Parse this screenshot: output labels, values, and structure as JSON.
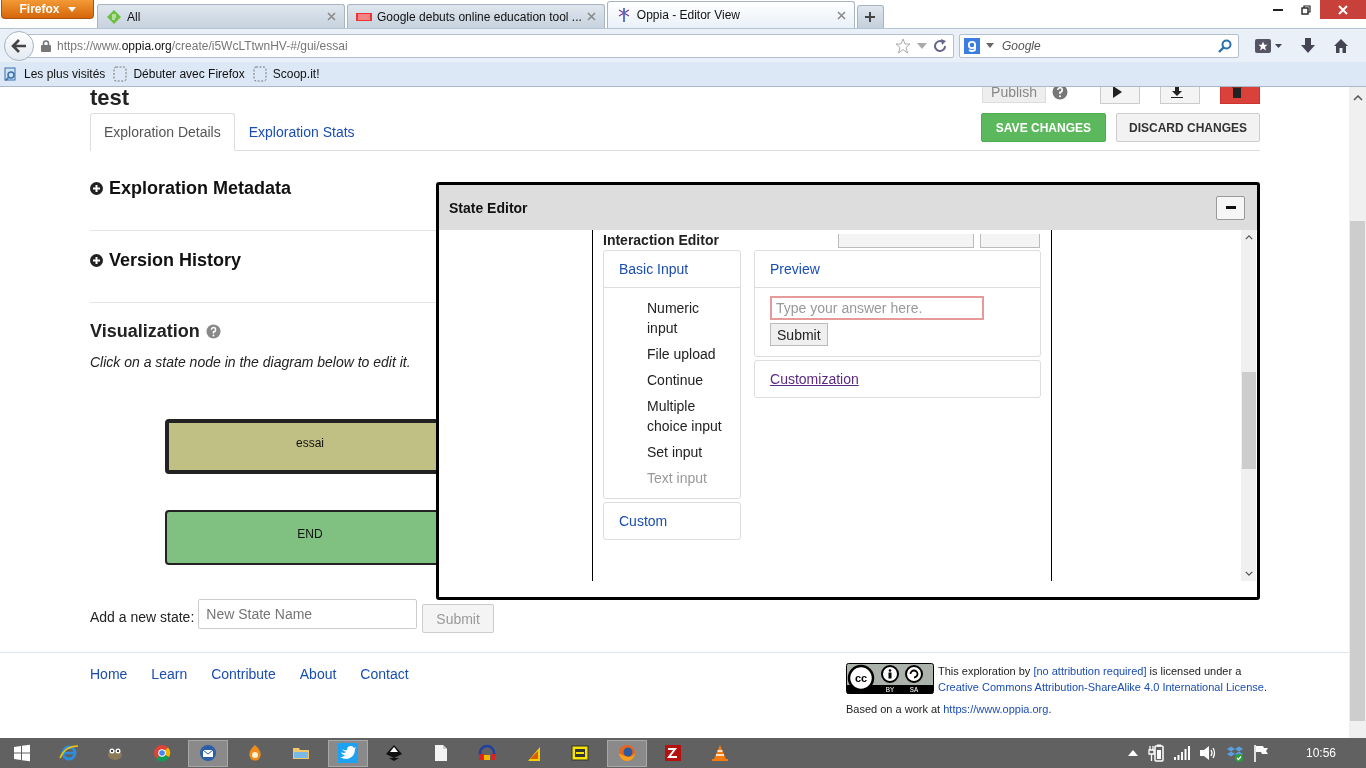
{
  "browser": {
    "menu_button": "Firefox",
    "tabs": [
      {
        "title": "All",
        "selected": false,
        "kind": "feed"
      },
      {
        "title": "Google debuts online education tool ...",
        "selected": false,
        "kind": "news"
      },
      {
        "title": "Oppia - Editor View",
        "selected": true,
        "kind": "site"
      }
    ],
    "address": {
      "prefix": "https://www.",
      "domain": "oppia.org",
      "path": "/create/i5WcLTtwnHV-#/gui/essai"
    },
    "search": {
      "placeholder": "Google"
    },
    "bookmarks": [
      {
        "label": "Les plus visités",
        "kind": "folder"
      },
      {
        "label": "Débuter avec Firefox",
        "kind": "page"
      },
      {
        "label": "Scoop.it!",
        "kind": "page"
      }
    ]
  },
  "page": {
    "title": "test",
    "publish_button": "Publish",
    "tabs": [
      {
        "label": "Exploration Details",
        "selected": true
      },
      {
        "label": "Exploration Stats",
        "selected": false
      }
    ],
    "save_button": "SAVE CHANGES",
    "discard_button": "DISCARD CHANGES",
    "sections": [
      {
        "title": "Exploration Metadata",
        "expanded": false
      },
      {
        "title": "Version History",
        "expanded": false
      }
    ],
    "visualization": {
      "title": "Visualization",
      "hint": "Click on a state node in the diagram below to edit it.",
      "nodes": [
        {
          "label": "essai",
          "selected": true,
          "color": "#c0c084"
        },
        {
          "label": "END",
          "selected": false,
          "color": "#80c080"
        }
      ]
    },
    "add_state": {
      "label": "Add a new state:",
      "placeholder": "New State Name",
      "submit": "Submit",
      "disabled": true
    }
  },
  "footer": {
    "links": [
      "Home",
      "Learn",
      "Contribute",
      "About",
      "Contact"
    ],
    "badge": {
      "mark": "cc",
      "labels": [
        "BY",
        "SA"
      ]
    },
    "license": [
      {
        "text": "This exploration by ",
        "kind": "plain"
      },
      {
        "text": "[no attribution required]",
        "kind": "link"
      },
      {
        "text": " is licensed under a ",
        "kind": "plain"
      },
      {
        "text": "Creative Commons Attribution-ShareAlike 4.0 International License",
        "kind": "link"
      },
      {
        "text": ".",
        "kind": "plain"
      }
    ],
    "source": [
      {
        "text": "Based on a work at ",
        "kind": "plain"
      },
      {
        "text": "https://www.oppia.org",
        "kind": "link"
      },
      {
        "text": ".",
        "kind": "plain"
      }
    ]
  },
  "state_editor": {
    "title": "State Editor",
    "heading": "Interaction Editor",
    "basic": {
      "title": "Basic Input",
      "items": [
        {
          "label": "Numeric input",
          "disabled": false
        },
        {
          "label": "File upload",
          "disabled": false
        },
        {
          "label": "Continue",
          "disabled": false
        },
        {
          "label": "Multiple choice input",
          "disabled": false
        },
        {
          "label": "Set input",
          "disabled": false
        },
        {
          "label": "Text input",
          "disabled": true
        }
      ]
    },
    "custom": "Custom",
    "preview": {
      "title": "Preview",
      "placeholder": "Type your answer here.",
      "submit": "Submit"
    },
    "customization": "Customization"
  },
  "taskbar": {
    "apps": [
      {
        "kind": "start",
        "selected": false
      },
      {
        "kind": "swirl",
        "selected": false
      },
      {
        "kind": "creature",
        "selected": false
      },
      {
        "kind": "wheel",
        "selected": false
      },
      {
        "kind": "envelope",
        "selected": true
      },
      {
        "kind": "flame",
        "selected": false
      },
      {
        "kind": "folder",
        "selected": false
      },
      {
        "kind": "bird",
        "selected": true
      },
      {
        "kind": "diamond",
        "selected": false
      },
      {
        "kind": "page",
        "selected": false
      },
      {
        "kind": "headphones",
        "selected": false
      },
      {
        "kind": "triangle",
        "selected": false
      },
      {
        "kind": "card",
        "selected": false
      },
      {
        "kind": "globe",
        "selected": true
      },
      {
        "kind": "zigzag",
        "selected": false
      },
      {
        "kind": "cone",
        "selected": false
      }
    ],
    "clock": "10:56"
  }
}
